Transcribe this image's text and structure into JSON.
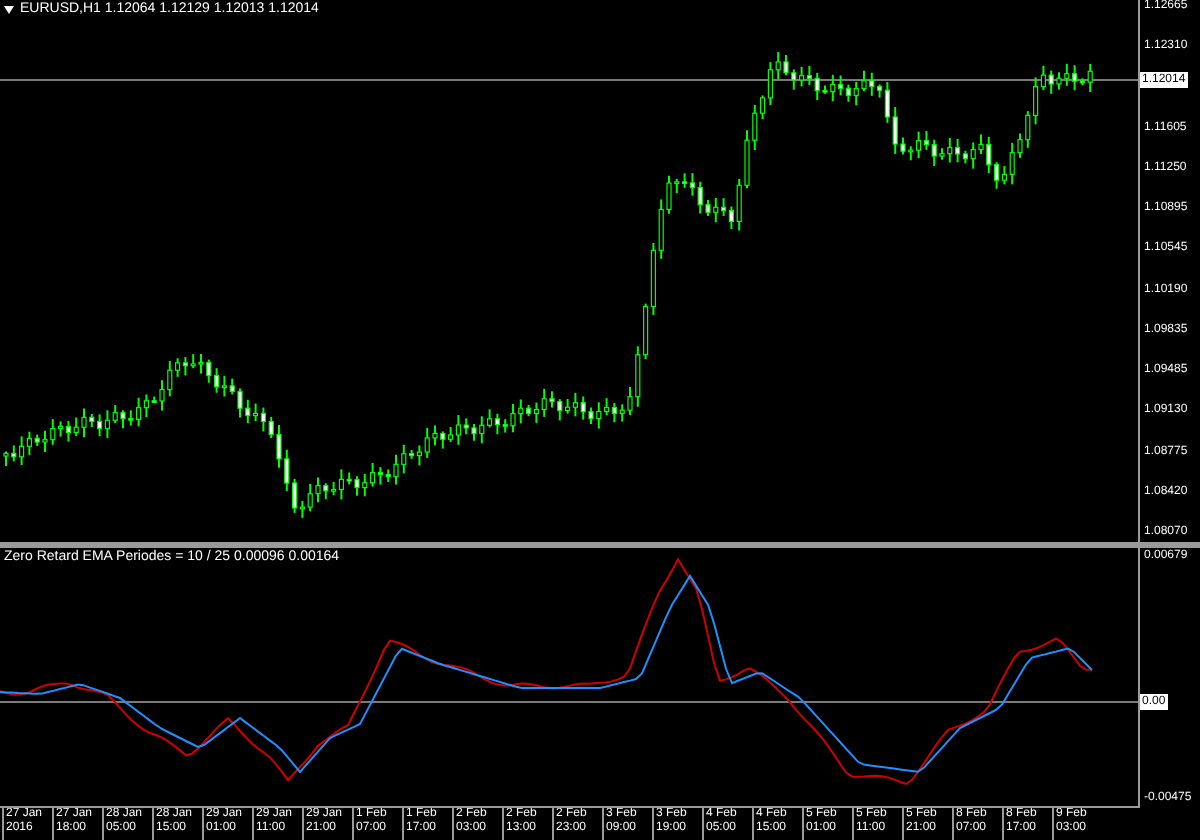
{
  "main_chart": {
    "header": "EURUSD,H1  1.12064 1.12129 1.12013 1.12014",
    "price_axis": {
      "labels": [
        "1.12665",
        "1.12310",
        "1.11605",
        "1.11250",
        "1.10895",
        "1.10545",
        "1.10190",
        "1.09835",
        "1.09485",
        "1.09130",
        "1.08775",
        "1.08420",
        "1.08070"
      ],
      "current_price": "1.12014"
    }
  },
  "indicator": {
    "title": "Zero Retard EMA Periodes = 10 / 25  0.00096 0.00164",
    "axis_labels": [
      "0.00679",
      "0.00",
      "-0.00475"
    ]
  },
  "time_axis": {
    "labels": [
      "27 Jan 2016",
      "27 Jan 18:00",
      "28 Jan 05:00",
      "28 Jan 15:00",
      "29 Jan 01:00",
      "29 Jan 11:00",
      "29 Jan 21:00",
      "1 Feb 07:00",
      "1 Feb 17:00",
      "2 Feb 03:00",
      "2 Feb 13:00",
      "2 Feb 23:00",
      "3 Feb 09:00",
      "3 Feb 19:00",
      "4 Feb 05:00",
      "4 Feb 15:00",
      "5 Feb 01:00",
      "5 Feb 11:00",
      "5 Feb 21:00",
      "8 Feb 07:00",
      "8 Feb 17:00",
      "9 Feb 03:00"
    ]
  }
}
